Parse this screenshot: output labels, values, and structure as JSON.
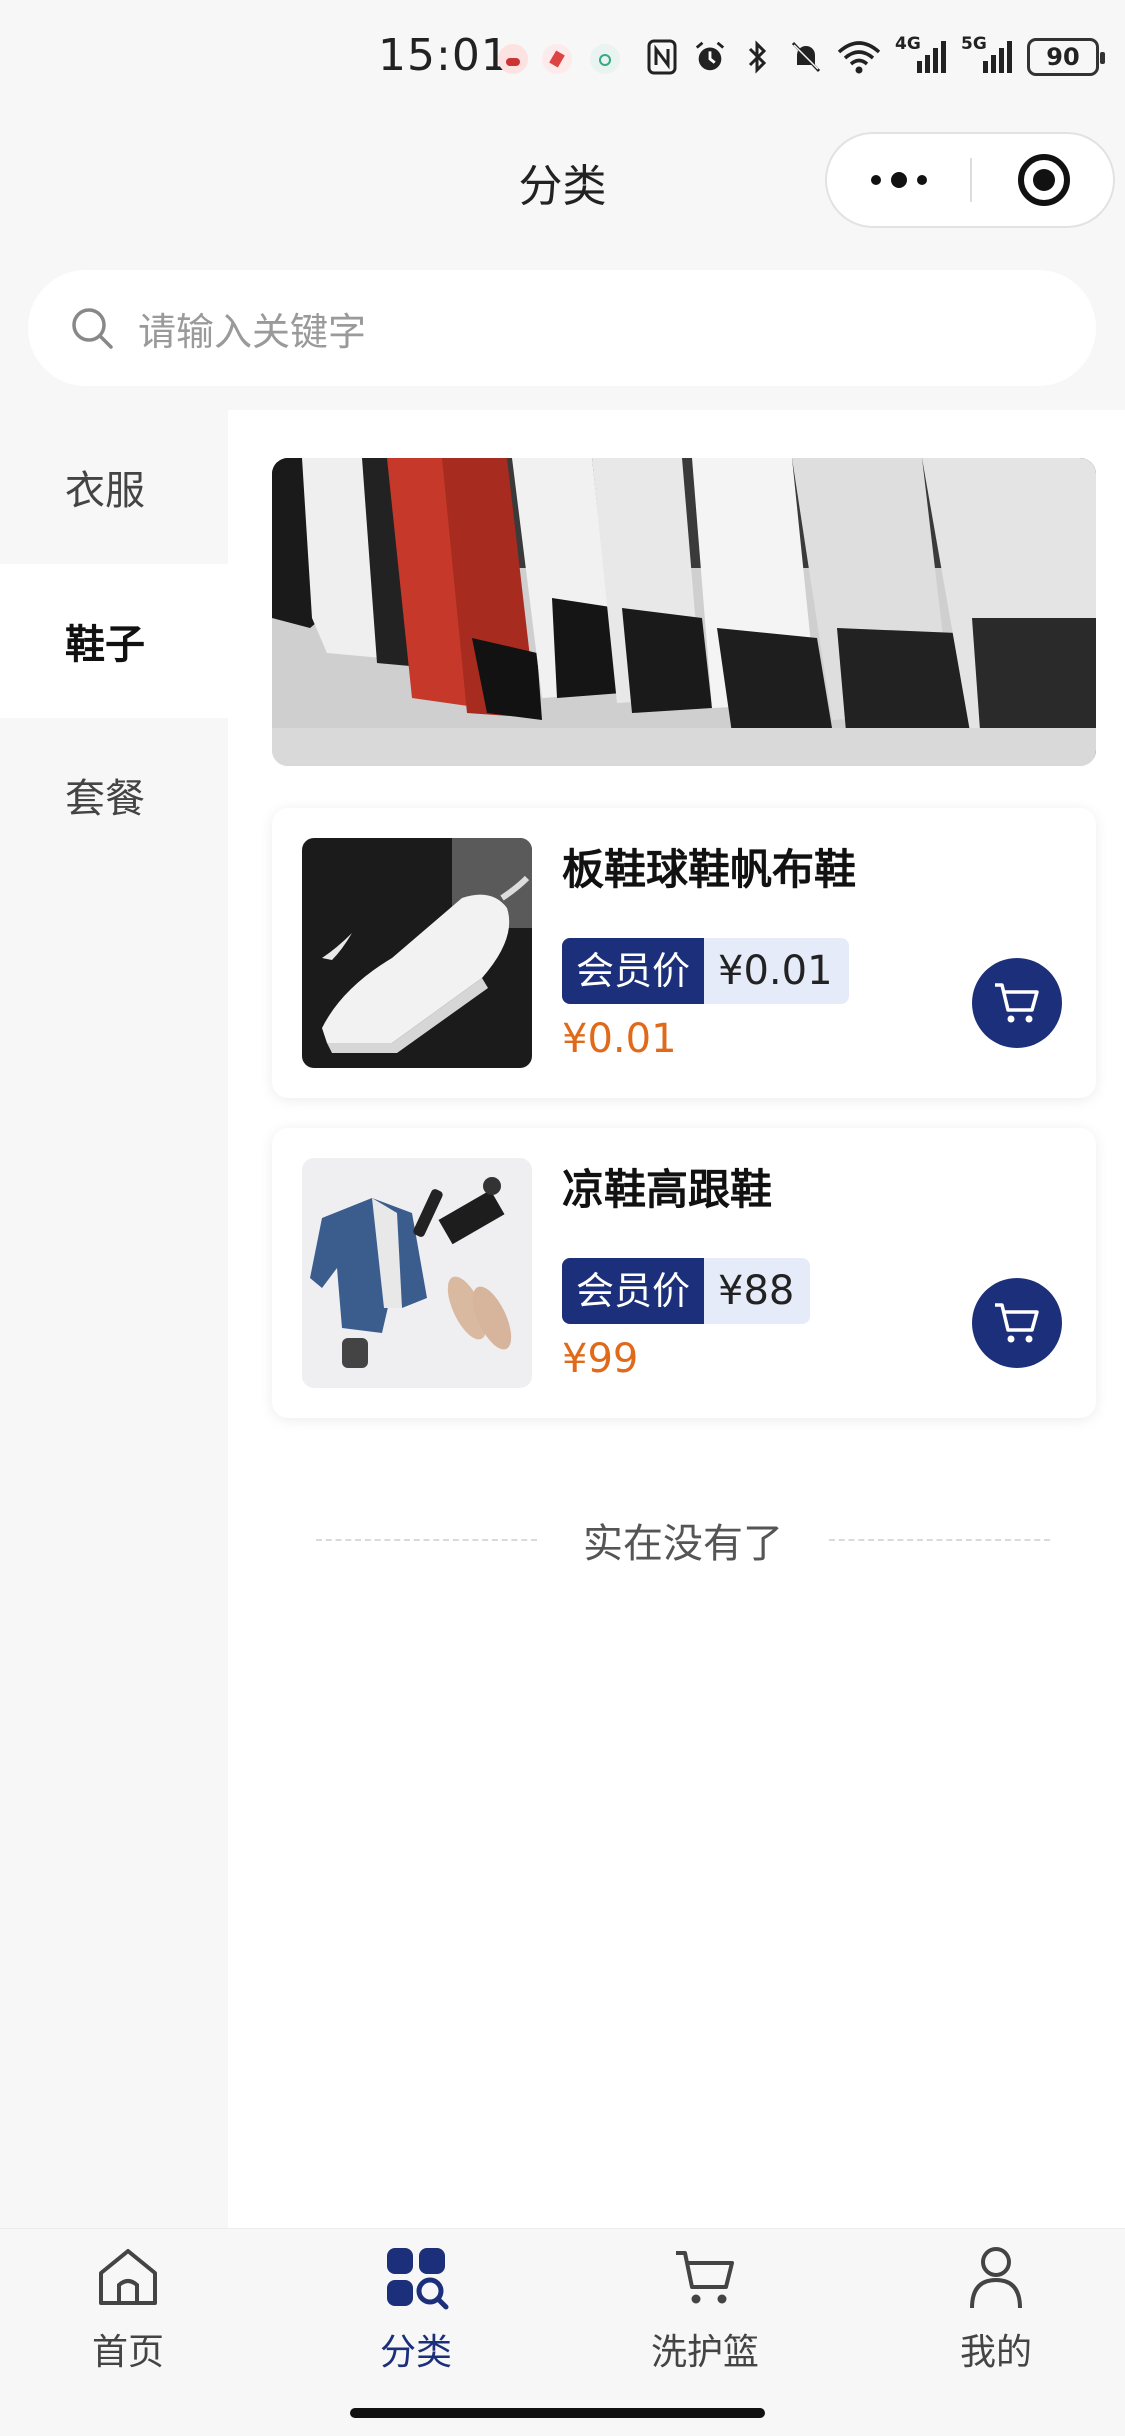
{
  "status_bar": {
    "time": "15:01",
    "network_4g": "4G",
    "network_5g": "5G",
    "battery": "90"
  },
  "header": {
    "title": "分类",
    "more_icon": "more-dots-icon",
    "close_icon": "target-circle-icon"
  },
  "search": {
    "placeholder": "请输入关键字"
  },
  "sidebar": {
    "items": [
      {
        "label": "衣服",
        "active": false
      },
      {
        "label": "鞋子",
        "active": true
      },
      {
        "label": "套餐",
        "active": false
      }
    ]
  },
  "products": [
    {
      "name": "板鞋球鞋帆布鞋",
      "member_tag": "会员价",
      "member_price": "¥0.01",
      "price": "¥0.01"
    },
    {
      "name": "凉鞋高跟鞋",
      "member_tag": "会员价",
      "member_price": "¥88",
      "price": "¥99"
    }
  ],
  "list_end": "实在没有了",
  "tabs": [
    {
      "label": "首页",
      "icon": "home-icon",
      "active": false
    },
    {
      "label": "分类",
      "icon": "category-icon",
      "active": true
    },
    {
      "label": "洗护篮",
      "icon": "cart-icon",
      "active": false
    },
    {
      "label": "我的",
      "icon": "user-icon",
      "active": false
    }
  ],
  "colors": {
    "accent": "#1c2f7a",
    "price": "#e06a1a",
    "member_bg": "#e6ebfa"
  }
}
